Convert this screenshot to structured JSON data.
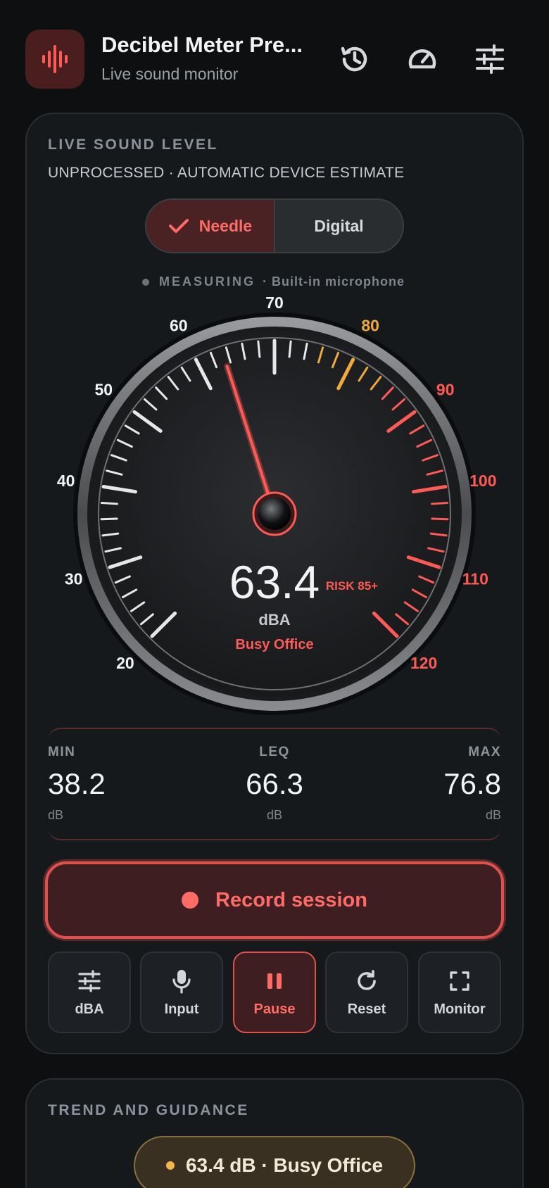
{
  "header": {
    "title": "Decibel Meter Pre...",
    "subtitle": "Live sound monitor",
    "icons": [
      "waveform-icon",
      "history-icon",
      "speedometer-icon",
      "sliders-icon"
    ]
  },
  "live": {
    "heading": "LIVE SOUND LEVEL",
    "subheading": "UNPROCESSED · AUTOMATIC DEVICE ESTIMATE",
    "modes": [
      "Needle",
      "Digital"
    ],
    "selected_mode": "Needle",
    "status_word": "MEASURING",
    "status_source": "· Built-in microphone"
  },
  "gauge": {
    "reading": "63.4",
    "unit": "dBA",
    "category": "Busy Office",
    "risk_label": "RISK 85+",
    "scale_min": 20,
    "scale_max": 120,
    "value": 63.4,
    "warning_from": 75,
    "danger_from": 85,
    "tick_labels": [
      "20",
      "30",
      "40",
      "50",
      "60",
      "70",
      "80",
      "90",
      "100",
      "110",
      "120"
    ],
    "colors": {
      "normal": "#e6e7e9",
      "warning": "#f2a93b",
      "danger": "#ff5a55",
      "needle": "#ff5a55"
    }
  },
  "stats": {
    "min": {
      "label": "MIN",
      "value": "38.2",
      "unit": "dB"
    },
    "leq": {
      "label": "LEQ",
      "value": "66.3",
      "unit": "dB"
    },
    "max": {
      "label": "MAX",
      "value": "76.8",
      "unit": "dB"
    }
  },
  "record": {
    "label": "Record session"
  },
  "tools": [
    {
      "label": "dBA",
      "icon": "sliders-icon"
    },
    {
      "label": "Input",
      "icon": "microphone-icon"
    },
    {
      "label": "Pause",
      "icon": "pause-icon",
      "active": true
    },
    {
      "label": "Reset",
      "icon": "refresh-icon"
    },
    {
      "label": "Monitor",
      "icon": "fullscreen-icon"
    }
  ],
  "trend": {
    "heading": "TREND AND GUIDANCE",
    "pill": "63.4 dB · Busy Office"
  },
  "accent": "#ff6b66"
}
